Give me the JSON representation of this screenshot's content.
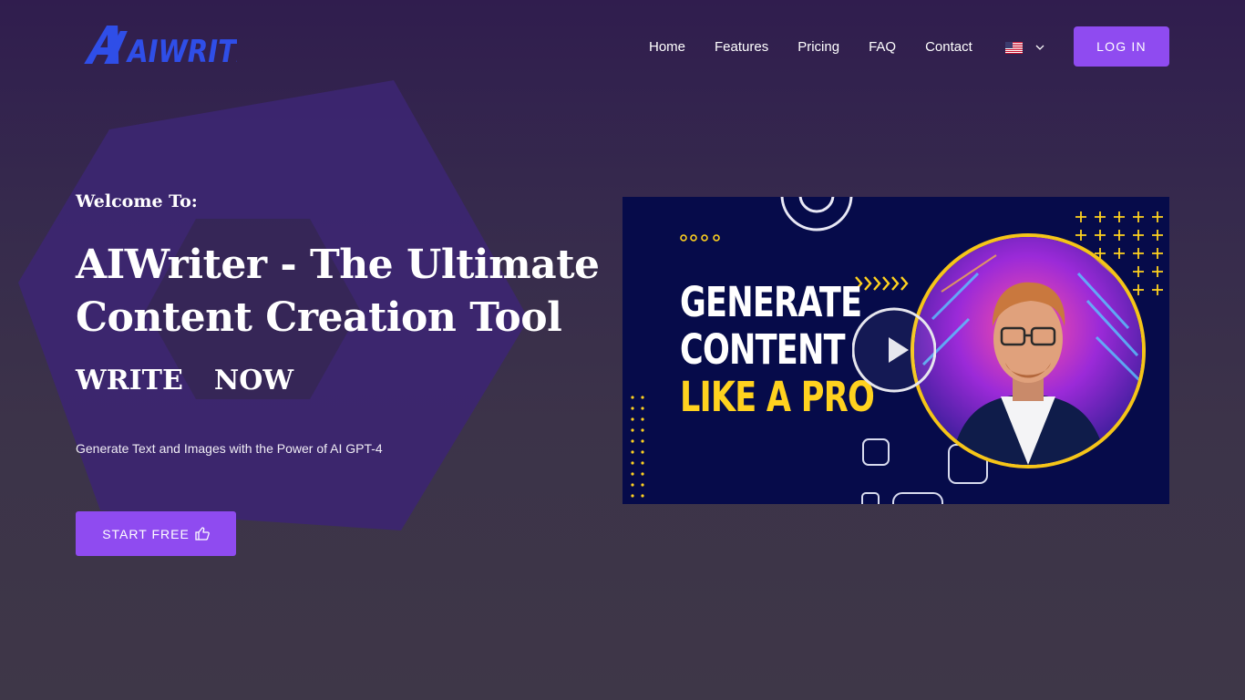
{
  "brand": {
    "name": "AIWRITER",
    "logo_icon": "aiwriter-logo",
    "accent_color": "#8f4bf0",
    "logo_color": "#2f4ee8"
  },
  "nav": {
    "links": [
      "Home",
      "Features",
      "Pricing",
      "FAQ",
      "Contact"
    ],
    "language_flag": "us-flag-icon",
    "login_label": "LOG IN"
  },
  "hero": {
    "welcome": "Welcome To:",
    "title": "AIWriter - The Ultimate Content Creation Tool",
    "typed_words": [
      "WRITE",
      "NOW"
    ],
    "subtitle": "Generate Text and Images with the Power of AI GPT-4",
    "cta_label": "START FREE",
    "cta_icon": "thumbs-up-icon"
  },
  "video": {
    "thumbnail_lines": [
      "GENERATE",
      "CONTENT",
      "LIKE A PRO"
    ],
    "play_icon": "play-icon",
    "highlight_color": "#ffd21f"
  }
}
